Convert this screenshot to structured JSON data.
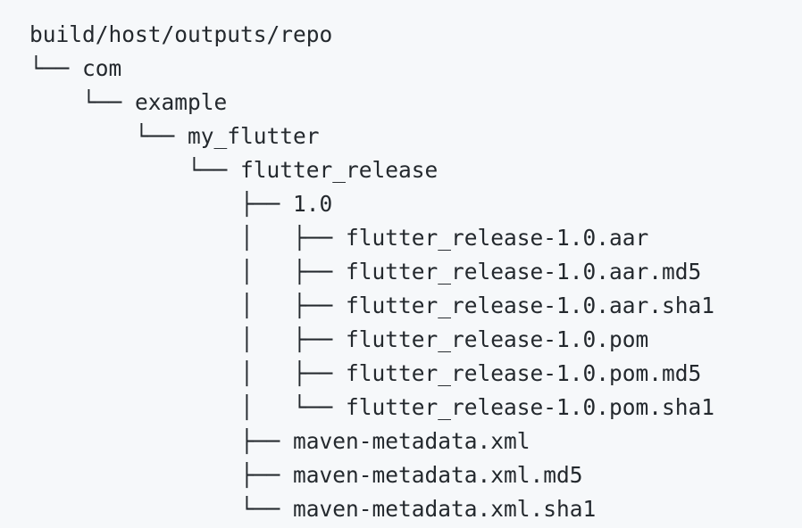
{
  "tree": {
    "lines": [
      {
        "prefix": "",
        "name": "build/host/outputs/repo"
      },
      {
        "prefix": "└── ",
        "name": "com"
      },
      {
        "prefix": "    └── ",
        "name": "example"
      },
      {
        "prefix": "        └── ",
        "name": "my_flutter"
      },
      {
        "prefix": "            └── ",
        "name": "flutter_release"
      },
      {
        "prefix": "                ├── ",
        "name": "1.0"
      },
      {
        "prefix": "                │   ├── ",
        "name": "flutter_release-1.0.aar"
      },
      {
        "prefix": "                │   ├── ",
        "name": "flutter_release-1.0.aar.md5"
      },
      {
        "prefix": "                │   ├── ",
        "name": "flutter_release-1.0.aar.sha1"
      },
      {
        "prefix": "                │   ├── ",
        "name": "flutter_release-1.0.pom"
      },
      {
        "prefix": "                │   ├── ",
        "name": "flutter_release-1.0.pom.md5"
      },
      {
        "prefix": "                │   └── ",
        "name": "flutter_release-1.0.pom.sha1"
      },
      {
        "prefix": "                ├── ",
        "name": "maven-metadata.xml"
      },
      {
        "prefix": "                ├── ",
        "name": "maven-metadata.xml.md5"
      },
      {
        "prefix": "                └── ",
        "name": "maven-metadata.xml.sha1"
      }
    ]
  }
}
